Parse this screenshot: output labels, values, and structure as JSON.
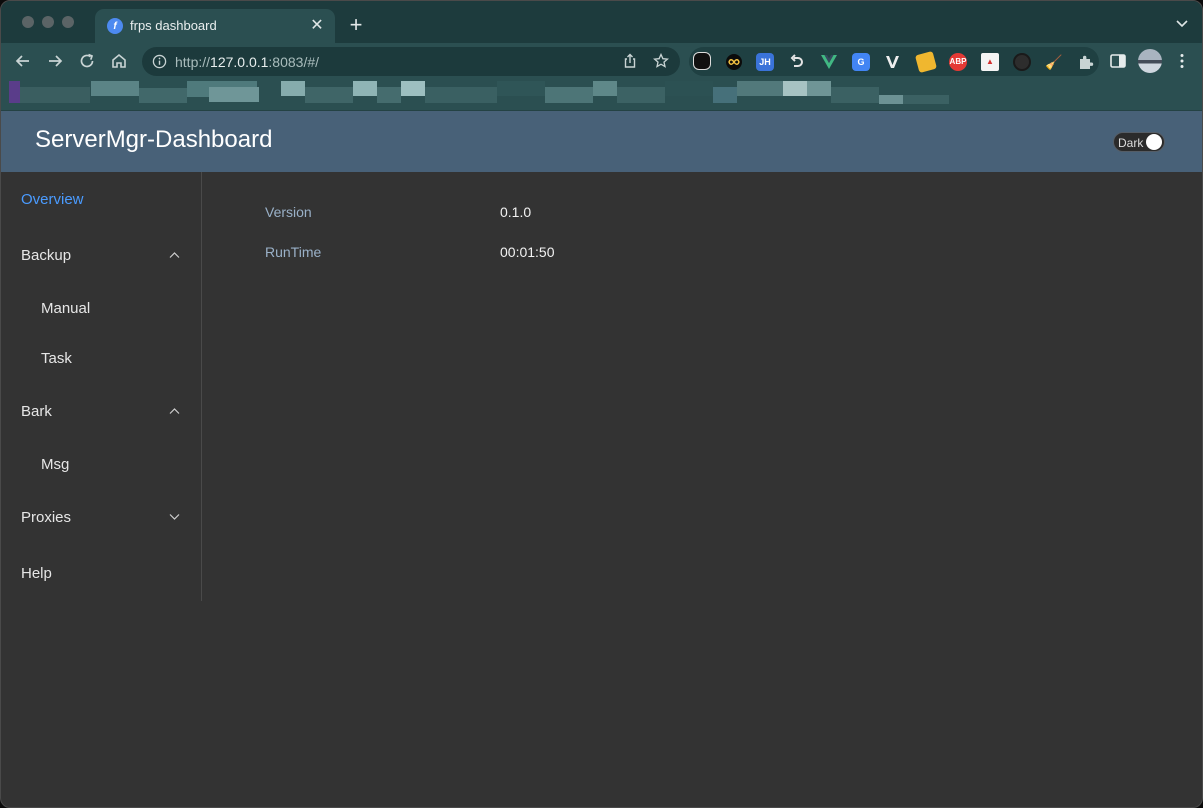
{
  "browser": {
    "tab": {
      "title": "frps dashboard",
      "favicon_icon": "feather-icon"
    },
    "omnibox": {
      "url_prefix": "http://",
      "url_host": "127.0.0.1",
      "url_suffix": ":8083/#/"
    },
    "extensions": [
      "ghostery-icon",
      "infinity-icon",
      "jh-icon",
      "undo-icon",
      "vue-icon",
      "translate-icon",
      "v-icon",
      "cheese-icon",
      "abp-icon",
      "pdf-icon",
      "dark-circle-icon",
      "broom-icon",
      "puzzle-icon"
    ],
    "extension_labels": {
      "jh": "JH",
      "abp": "ABP"
    }
  },
  "app": {
    "title": "ServerMgr-Dashboard",
    "theme_toggle": {
      "label": "Dark",
      "state": "on"
    }
  },
  "sidebar": {
    "items": [
      {
        "label": "Overview",
        "active": true
      },
      {
        "label": "Backup",
        "expanded": true
      },
      {
        "label": "Manual"
      },
      {
        "label": "Task"
      },
      {
        "label": "Bark",
        "expanded": true
      },
      {
        "label": "Msg"
      },
      {
        "label": "Proxies",
        "expanded": false
      },
      {
        "label": "Help"
      }
    ]
  },
  "overview": {
    "rows": [
      {
        "label": "Version",
        "value": "0.1.0"
      },
      {
        "label": "RunTime",
        "value": "00:01:50"
      }
    ]
  },
  "colors": {
    "header_bg": "#486178",
    "page_bg": "#333333",
    "active_link": "#4a9bff",
    "label_text": "#9ab1c8"
  }
}
